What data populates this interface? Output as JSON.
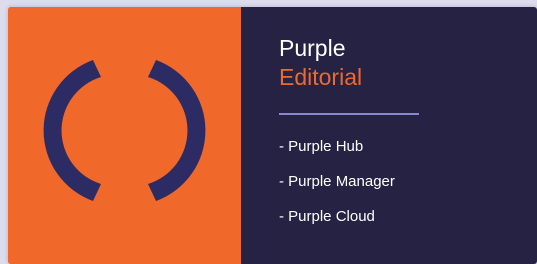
{
  "colors": {
    "accent_orange": "#f0692a",
    "navy": "#252244",
    "logo_navy": "#2d2b63",
    "divider": "#8a86c8",
    "text_white": "#ffffff"
  },
  "logo": {
    "icon": "purple-logo-brackets-icon"
  },
  "brand": {
    "name_line1": "Purple",
    "name_line2": "Editorial"
  },
  "products": [
    {
      "label": "- Purple Hub"
    },
    {
      "label": "- Purple Manager"
    },
    {
      "label": "- Purple Cloud"
    }
  ]
}
